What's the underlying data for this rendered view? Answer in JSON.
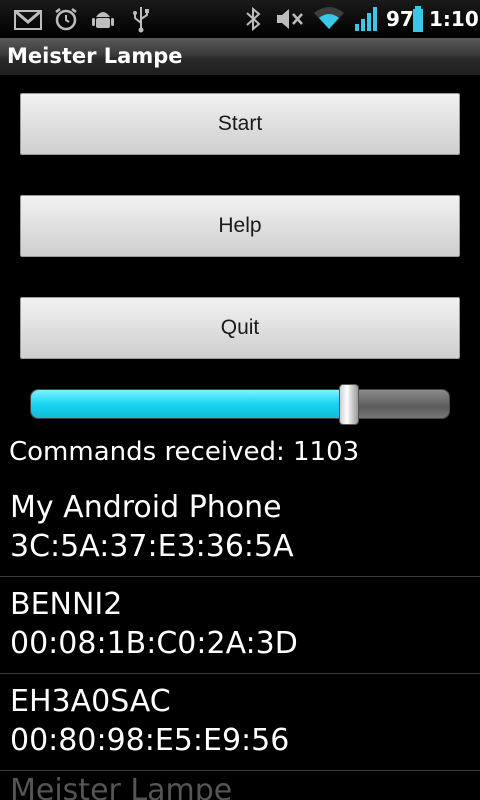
{
  "status_bar": {
    "battery_level": "97",
    "time": "1:10",
    "icons": [
      "gmail-icon",
      "alarm-icon",
      "android-debug-icon",
      "usb-icon",
      "bluetooth-icon",
      "mute-icon",
      "wifi-icon",
      "signal-icon",
      "battery-icon"
    ],
    "colors": {
      "signal": "#39c8e8",
      "battery": "#39c8e8"
    }
  },
  "app": {
    "title": "Meister Lampe"
  },
  "buttons": {
    "start": "Start",
    "help": "Help",
    "quit": "Quit"
  },
  "slider": {
    "level_percent": 76,
    "fill_color": "#19d6f2"
  },
  "commands": {
    "text": "Commands received: 1103"
  },
  "devices": [
    {
      "name": "My Android Phone",
      "address": "3C:5A:37:E3:36:5A"
    },
    {
      "name": "BENNI2",
      "address": "00:08:1B:C0:2A:3D"
    },
    {
      "name": "EH3A0SAC",
      "address": "00:80:98:E5:E9:56"
    }
  ],
  "partial_item": "Meister Lampe"
}
